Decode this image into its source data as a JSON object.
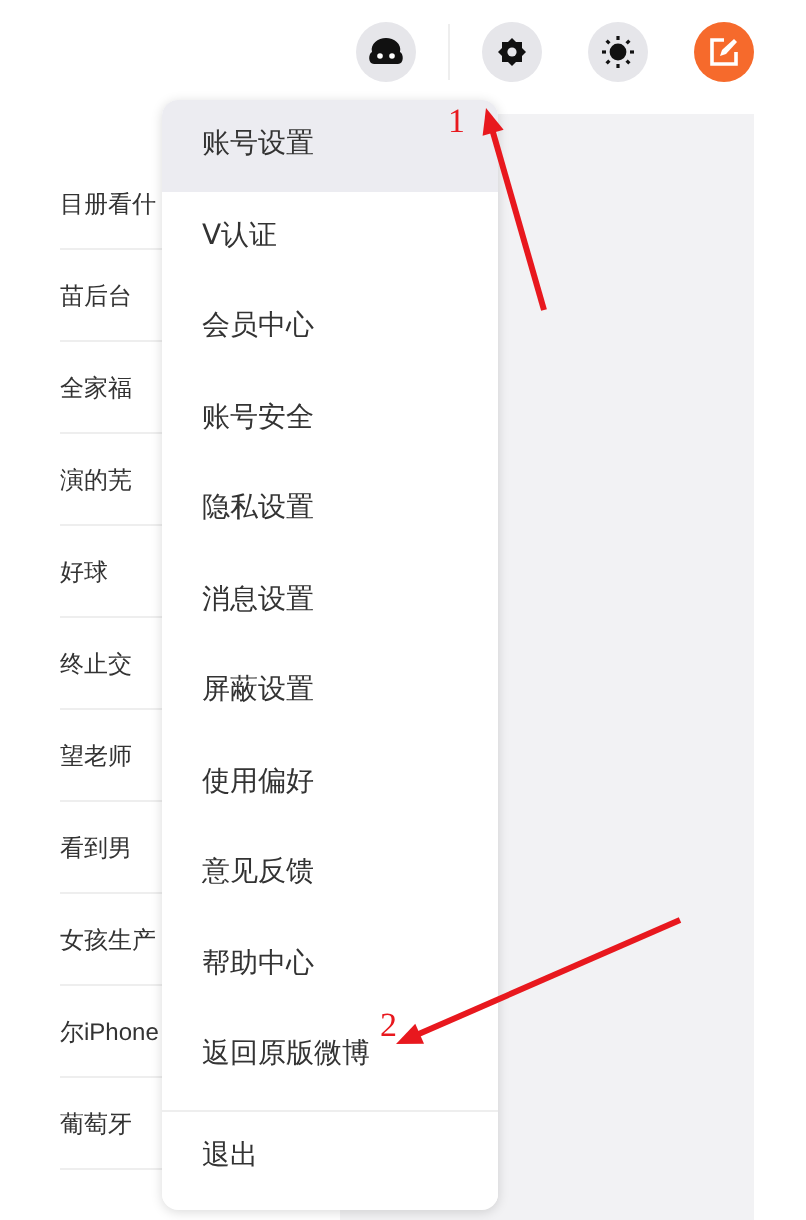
{
  "toolbar": {
    "buttons": [
      {
        "kind": "game"
      },
      {
        "kind": "settings"
      },
      {
        "kind": "theme"
      },
      {
        "kind": "compose"
      }
    ]
  },
  "feed": {
    "rows": [
      {
        "title": "目册看什"
      },
      {
        "title": "苗后台"
      },
      {
        "title": "全家福"
      },
      {
        "title": "演的芜"
      },
      {
        "title": "好球"
      },
      {
        "title": "终止交"
      },
      {
        "title": "望老师"
      },
      {
        "title": "看到男"
      },
      {
        "title": "女孩生产"
      },
      {
        "title": "尔iPhone"
      },
      {
        "title": "葡萄牙"
      }
    ]
  },
  "menu": {
    "items": [
      {
        "label": "账号设置",
        "selected": true
      },
      {
        "label": "V认证",
        "selected": false
      },
      {
        "label": "会员中心",
        "selected": false
      },
      {
        "label": "账号安全",
        "selected": false
      },
      {
        "label": "隐私设置",
        "selected": false
      },
      {
        "label": "消息设置",
        "selected": false
      },
      {
        "label": "屏蔽设置",
        "selected": false
      },
      {
        "label": "使用偏好",
        "selected": false
      },
      {
        "label": "意见反馈",
        "selected": false
      },
      {
        "label": "帮助中心",
        "selected": false
      },
      {
        "label": "返回原版微博",
        "selected": false
      },
      {
        "label": "退出",
        "selected": false,
        "separated": true
      }
    ]
  },
  "annotations": [
    {
      "label": "1"
    },
    {
      "label": "2"
    }
  ]
}
